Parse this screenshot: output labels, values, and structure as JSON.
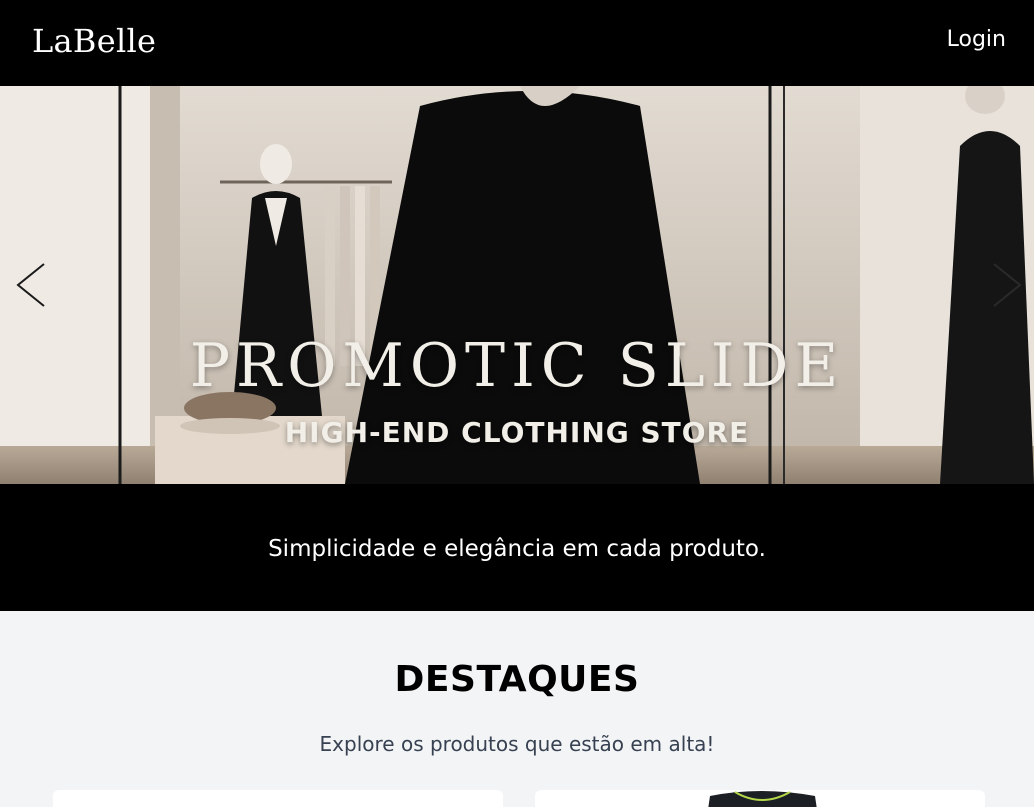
{
  "navbar": {
    "logo": "LaBelle",
    "login_label": "Login"
  },
  "carousel": {
    "slide_title": "PROMOTIC SLIDE",
    "slide_subtitle": "HIGH-END CLOTHING STORE",
    "prev_icon": "chevron-left-icon",
    "next_icon": "chevron-right-icon"
  },
  "tagline": "Simplicidade e elegância em cada produto.",
  "featured": {
    "title": "DESTAQUES",
    "subtitle": "Explore os produtos que estão em alta!",
    "products": [
      "",
      ""
    ]
  },
  "colors": {
    "navbar_bg": "#000000",
    "page_bg": "#f3f4f6",
    "text_light": "#ffffff",
    "text_muted": "#374151"
  }
}
